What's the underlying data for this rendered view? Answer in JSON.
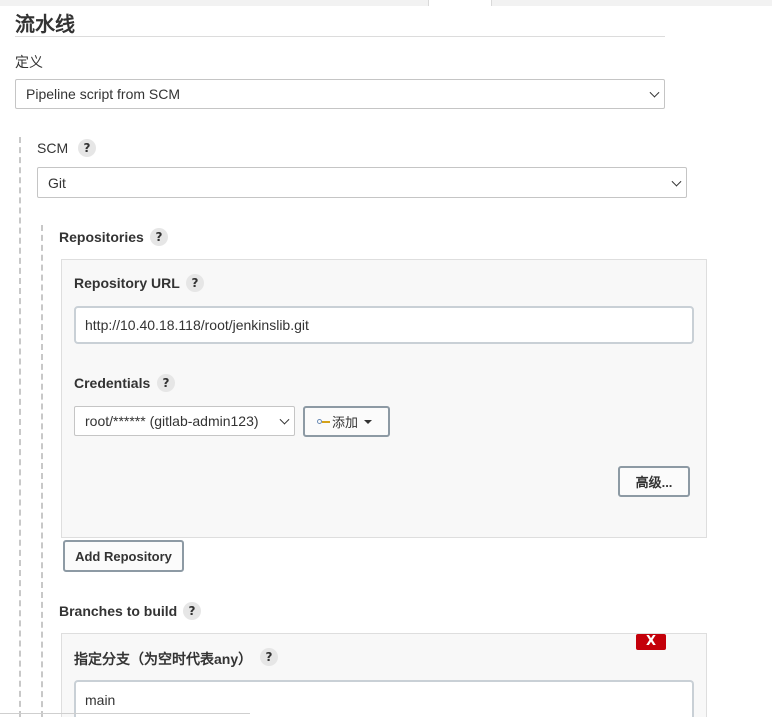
{
  "section": {
    "title": "流水线"
  },
  "definition": {
    "label": "定义",
    "selected": "Pipeline script from SCM"
  },
  "scm": {
    "label": "SCM",
    "help": "?",
    "selected": "Git"
  },
  "repositories": {
    "label": "Repositories",
    "help": "?",
    "repository_url": {
      "label": "Repository URL",
      "help": "?",
      "value": "http://10.40.18.118/root/jenkinslib.git"
    },
    "credentials": {
      "label": "Credentials",
      "help": "?",
      "selected": "root/****** (gitlab-admin123)",
      "add_label": "添加"
    },
    "advanced_label": "高级...",
    "add_repository_label": "Add Repository"
  },
  "branches": {
    "label": "Branches to build",
    "help": "?",
    "delete_label": "X",
    "specifier": {
      "label": "指定分支（为空时代表any）",
      "help": "?",
      "value": "main"
    }
  },
  "colors": {
    "delete": "#c4000a",
    "border": "#c9d0d6",
    "panel": "#f8f8f8"
  }
}
